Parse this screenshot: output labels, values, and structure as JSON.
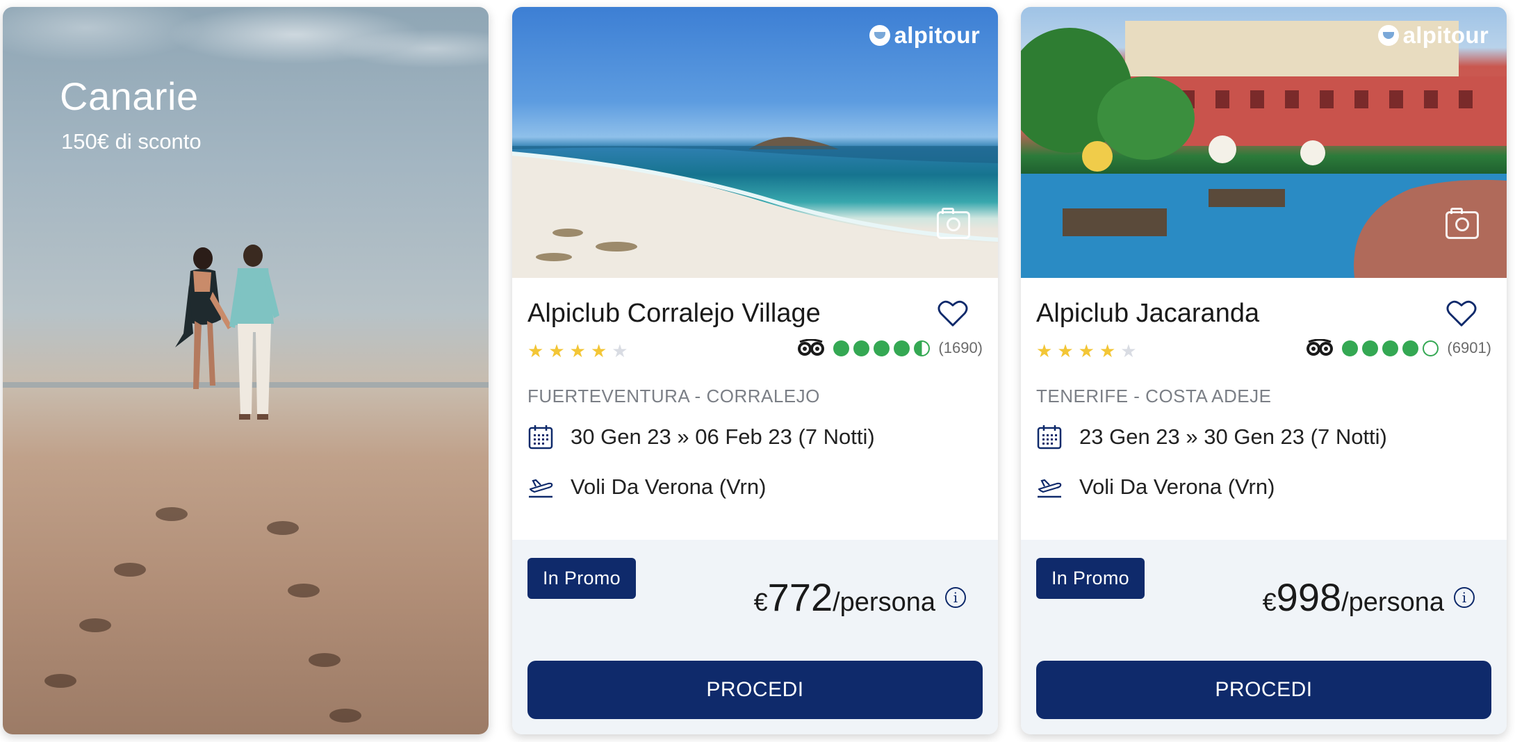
{
  "promo": {
    "title": "Canarie",
    "subtitle": "150€ di sconto"
  },
  "brand": {
    "logo_text": "alpitour",
    "navy": "#0f2a6b",
    "tripadvisor_green": "#34a853",
    "star_gold": "#f3c636"
  },
  "cards": [
    {
      "name": "Alpiclub Corralejo Village",
      "stars": 4,
      "tripadvisor_rating": 4.5,
      "review_count": "(1690)",
      "location": "FUERTEVENTURA - CORRALEJO",
      "dates": "30 Gen 23 » 06 Feb 23 (7 Notti)",
      "flight": "Voli Da Verona (Vrn)",
      "badge": "In Promo",
      "currency": "€",
      "price": "772",
      "price_unit": "/persona",
      "info_icon": "i",
      "cta": "PROCEDI",
      "icons": [
        "camera-icon",
        "heart-icon",
        "calendar-icon",
        "plane-icon",
        "info-icon"
      ]
    },
    {
      "name": "Alpiclub Jacaranda",
      "stars": 4,
      "tripadvisor_rating": 4,
      "review_count": "(6901)",
      "location": "TENERIFE - COSTA ADEJE",
      "dates": "23 Gen 23 » 30 Gen 23 (7 Notti)",
      "flight": "Voli Da Verona (Vrn)",
      "badge": "In Promo",
      "currency": "€",
      "price": "998",
      "price_unit": "/persona",
      "info_icon": "i",
      "cta": "PROCEDI",
      "icons": [
        "camera-icon",
        "heart-icon",
        "calendar-icon",
        "plane-icon",
        "info-icon"
      ]
    }
  ]
}
